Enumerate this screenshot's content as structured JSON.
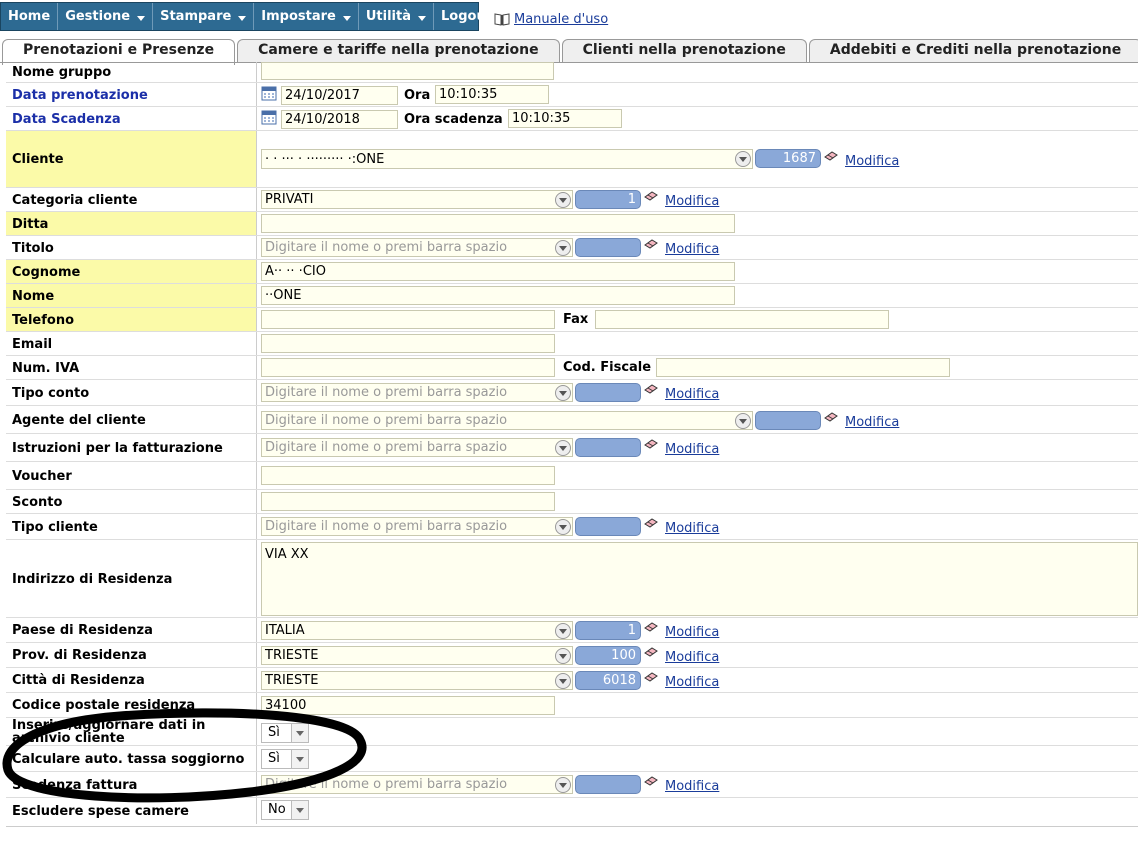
{
  "menu": {
    "home": "Home",
    "gestione": "Gestione",
    "stampare": "Stampare",
    "impostare": "Impostare",
    "utilita": "Utilità",
    "logout": "Logout"
  },
  "manual_link": "Manuale d'uso",
  "tabs": [
    "Prenotazioni e Presenze",
    "Camere e tariffe nella prenotazione",
    "Clienti nella prenotazione",
    "Addebiti e Crediti nella prenotazione"
  ],
  "modifica": "Modifica",
  "placeholder": "Digitare il nome o premi barra spazio",
  "fields": {
    "nome_gruppo": {
      "label": "Nome gruppo"
    },
    "data_prenotazione": {
      "label": "Data prenotazione",
      "value": "24/10/2017",
      "ora_label": "Ora",
      "ora_value": "10:10:35"
    },
    "data_scadenza": {
      "label": "Data Scadenza",
      "value": "24/10/2018",
      "ora_label": "Ora scadenza",
      "ora_value": "10:10:35"
    },
    "cliente": {
      "label": "Cliente",
      "value": "  ·  · ··· ·  ·········  ·:ONE",
      "code": "1687"
    },
    "categoria_cliente": {
      "label": "Categoria cliente",
      "value": "PRIVATI",
      "code": "1"
    },
    "ditta": {
      "label": "Ditta"
    },
    "titolo": {
      "label": "Titolo"
    },
    "cognome": {
      "label": "Cognome",
      "value": "A·· ··  ·CIO"
    },
    "nome": {
      "label": "Nome",
      "value": "··ONE"
    },
    "telefono": {
      "label": "Telefono",
      "fax_label": "Fax"
    },
    "email": {
      "label": "Email"
    },
    "num_iva": {
      "label": "Num. IVA",
      "cf_label": "Cod. Fiscale"
    },
    "tipo_conto": {
      "label": "Tipo conto"
    },
    "agente": {
      "label": "Agente del cliente"
    },
    "istruzioni": {
      "label": "Istruzioni per la fatturazione"
    },
    "voucher": {
      "label": "Voucher"
    },
    "sconto": {
      "label": "Sconto"
    },
    "tipo_cliente": {
      "label": "Tipo cliente"
    },
    "indirizzo": {
      "label": "Indirizzo di Residenza",
      "value": "VIA XX"
    },
    "paese": {
      "label": "Paese di Residenza",
      "value": "ITALIA",
      "code": "1"
    },
    "prov": {
      "label": "Prov. di Residenza",
      "value": "TRIESTE",
      "code": "100"
    },
    "citta": {
      "label": "Città di Residenza",
      "value": "TRIESTE",
      "code": "6018"
    },
    "cap": {
      "label": "Codice postale residenza",
      "value": "34100"
    },
    "inserire": {
      "label": "Inserire/aggiornare dati in archivio cliente",
      "value": "Sì"
    },
    "tassa": {
      "label": "Calculare auto. tassa soggiorno",
      "value": "Sì"
    },
    "scadenza_fattura": {
      "label": "Scadenza fattura"
    },
    "escludere": {
      "label": "Escludere spese camere",
      "value": "No"
    }
  }
}
